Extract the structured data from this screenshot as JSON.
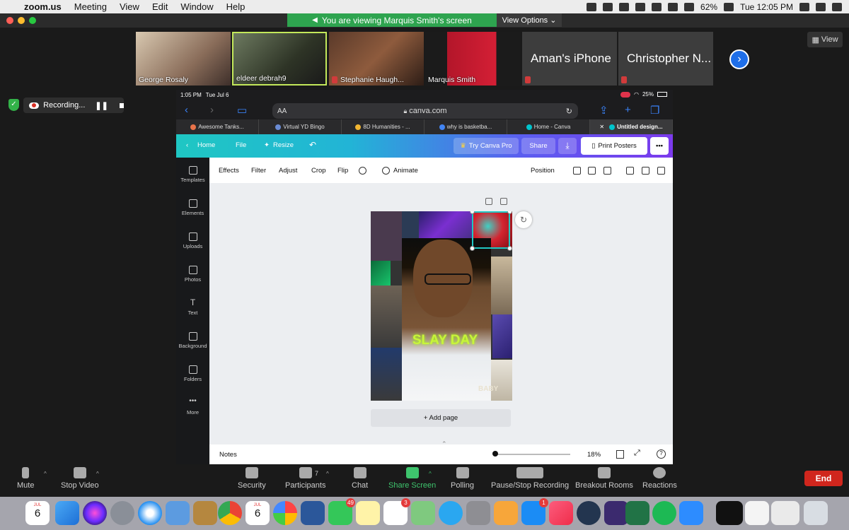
{
  "menubar": {
    "app": "zoom.us",
    "menus": [
      "Meeting",
      "View",
      "Edit",
      "Window",
      "Help"
    ],
    "battery": "62%",
    "clock": "Tue 12:05 PM"
  },
  "banner": {
    "viewing": "You are viewing Marquis Smith's screen",
    "view_options": "View Options"
  },
  "gallery": {
    "tiles": [
      {
        "name": "George Rosaly"
      },
      {
        "name": "eldeer debrah9"
      },
      {
        "name": "Stephanie Haugh..."
      },
      {
        "name": "Marquis Smith"
      },
      {
        "name": "Aman's iPhone"
      },
      {
        "name": "Christopher N..."
      }
    ],
    "view_label": "View"
  },
  "recording": {
    "label": "Recording..."
  },
  "ipad": {
    "status_time": "1:05 PM",
    "status_date": "Tue Jul 6",
    "status_battery": "25%",
    "url_aa": "AA",
    "url": "canva.com",
    "tabs": [
      {
        "label": "Awesome Tanks...",
        "color": "#e8734a"
      },
      {
        "label": "Virtual YD Bingo",
        "color": "#6a8bd4"
      },
      {
        "label": "8D Humanities - ...",
        "color": "#f2b632"
      },
      {
        "label": "why is basketba...",
        "color": "#4285f4"
      },
      {
        "label": "Home - Canva",
        "color": "#00c4cc"
      },
      {
        "label": "Untitled design...",
        "color": "#00c4cc"
      }
    ],
    "canva": {
      "home": "Home",
      "file": "File",
      "resize": "Resize",
      "try_pro": "Try Canva Pro",
      "share": "Share",
      "print": "Print Posters",
      "more": "•••"
    },
    "sidebar": [
      "Templates",
      "Elements",
      "Uploads",
      "Photos",
      "Text",
      "Background",
      "Folders",
      "More"
    ],
    "toolbar": {
      "effects": "Effects",
      "filter": "Filter",
      "adjust": "Adjust",
      "crop": "Crop",
      "flip": "Flip",
      "animate": "Animate",
      "position": "Position"
    },
    "design_text": {
      "slay": "SLAY DAY",
      "baby": "BABY"
    },
    "add_page": "+ Add page",
    "notes": "Notes",
    "zoom_pct": "18%"
  },
  "controls": {
    "mute": "Mute",
    "stop_video": "Stop Video",
    "security": "Security",
    "participants": "Participants",
    "participants_count": "7",
    "chat": "Chat",
    "share_screen": "Share Screen",
    "polling": "Polling",
    "pause_recording": "Pause/Stop Recording",
    "breakout": "Breakout Rooms",
    "reactions": "Reactions",
    "end": "End"
  },
  "dock": {
    "calendar_month": "JUL",
    "calendar_day": "6",
    "facetime_badge": "49",
    "reminders_badge": "3",
    "appstore_badge": "1"
  }
}
